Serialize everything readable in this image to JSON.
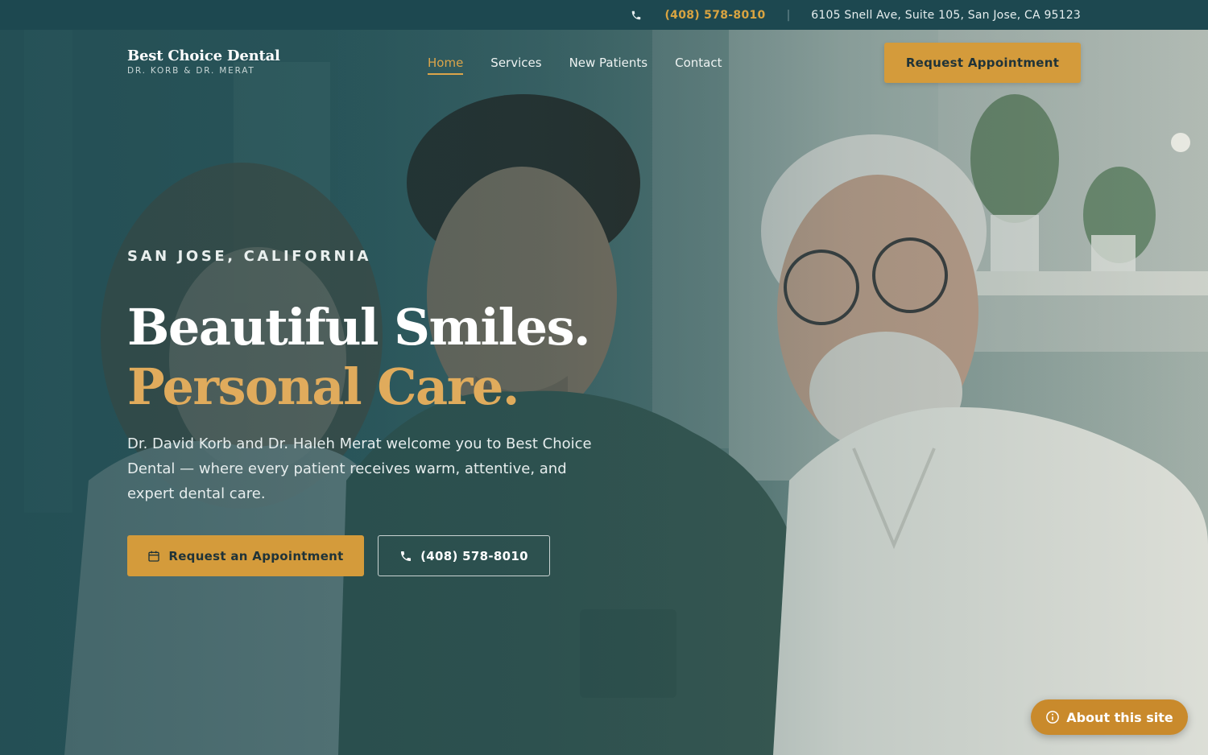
{
  "topbar": {
    "phone": "(408) 578-8010",
    "separator": "|",
    "address": "6105 Snell Ave, Suite 105, San Jose, CA 95123"
  },
  "brand": {
    "name": "Best Choice Dental",
    "subtitle": "DR. KORB & DR. MERAT"
  },
  "nav": {
    "items": [
      {
        "label": "Home",
        "active": true
      },
      {
        "label": "Services",
        "active": false
      },
      {
        "label": "New Patients",
        "active": false
      },
      {
        "label": "Contact",
        "active": false
      }
    ],
    "cta_label": "Request Appointment"
  },
  "hero": {
    "eyebrow": "SAN JOSE, CALIFORNIA",
    "headline_line1": "Beautiful Smiles.",
    "headline_line2": "Personal Care.",
    "lead": "Dr. David Korb and Dr. Haleh Merat welcome you to Best Choice Dental — where every patient receives warm, attentive, and expert dental care.",
    "primary_button": "Request an Appointment",
    "secondary_button": "(408) 578-8010"
  },
  "floating": {
    "about_label": "About this site"
  },
  "colors": {
    "topbar_bg": "#1d4850",
    "accent_gold": "#d49b3b",
    "headline_gold": "#e0ab5c"
  },
  "icons": {
    "topbar_phone": "phone-icon",
    "primary_button": "calendar-icon",
    "secondary_button": "phone-icon",
    "about": "info-icon"
  }
}
